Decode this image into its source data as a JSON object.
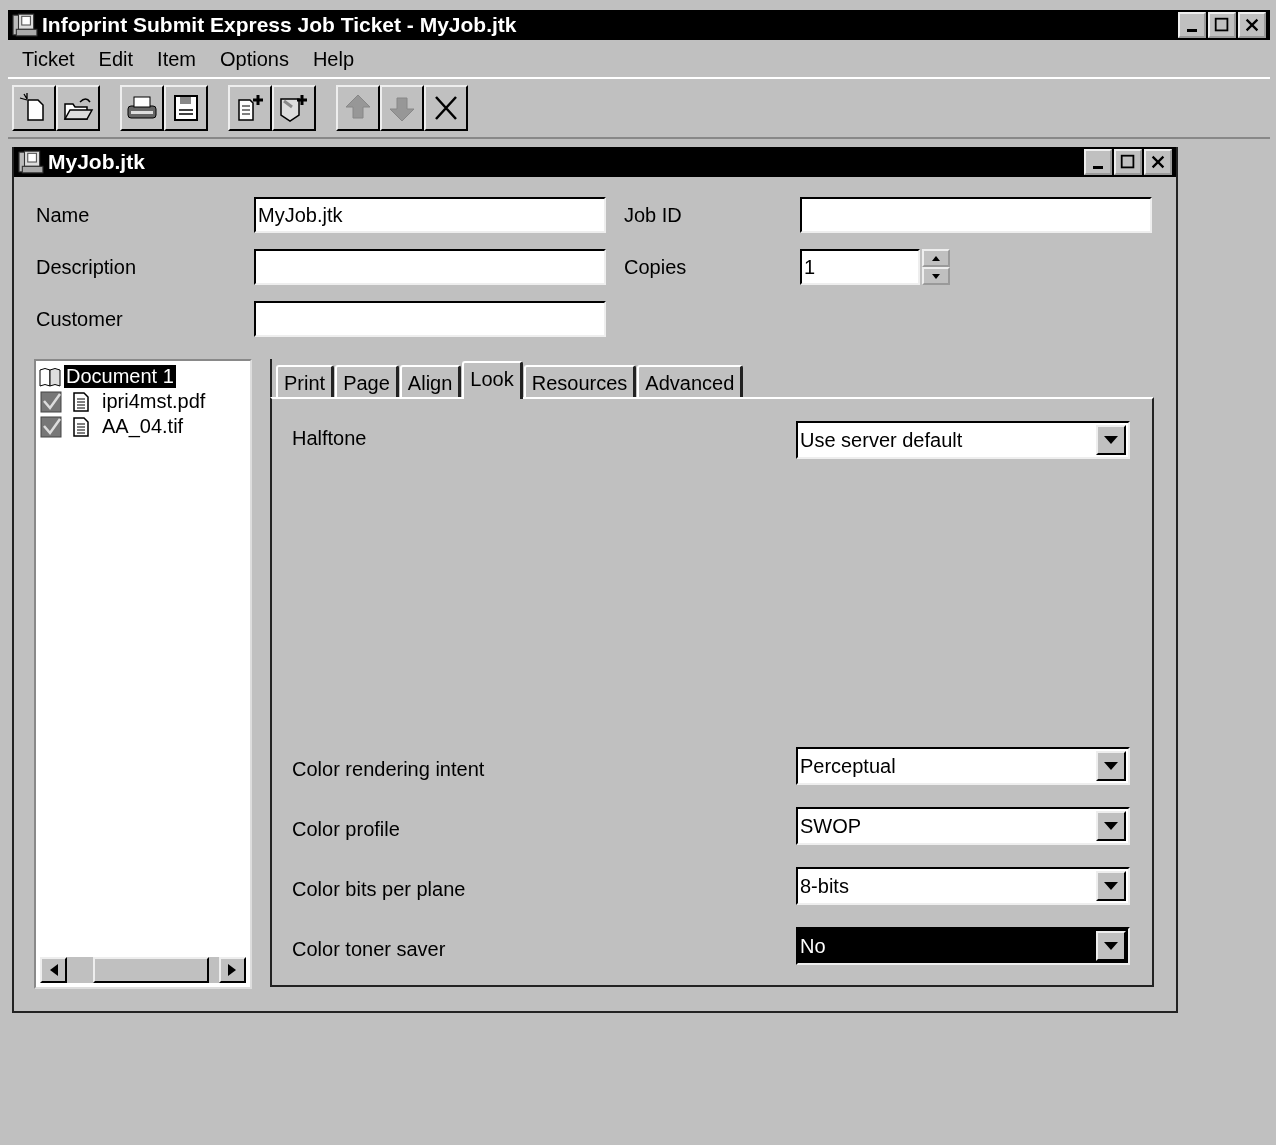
{
  "window": {
    "title": "Infoprint Submit Express Job Ticket - MyJob.jtk"
  },
  "menu": [
    {
      "label": "Ticket"
    },
    {
      "label": "Edit"
    },
    {
      "label": "Item"
    },
    {
      "label": "Options"
    },
    {
      "label": "Help"
    }
  ],
  "toolbar": [
    {
      "kind": "new",
      "disabled": false
    },
    {
      "kind": "open",
      "disabled": false
    },
    {
      "kind": "print",
      "disabled": false
    },
    {
      "kind": "save",
      "disabled": false
    },
    {
      "kind": "add-file",
      "disabled": false
    },
    {
      "kind": "add-document",
      "disabled": false
    },
    {
      "kind": "up",
      "disabled": true
    },
    {
      "kind": "down",
      "disabled": true
    },
    {
      "kind": "delete",
      "disabled": false
    }
  ],
  "document_window": {
    "title": "MyJob.jtk"
  },
  "fields": [
    {
      "label": "Name",
      "value": "MyJob.jtk",
      "kind": "text"
    },
    {
      "label": "Job ID",
      "kind": "text"
    },
    {
      "label": "Description",
      "kind": "text"
    },
    {
      "label": "Copies",
      "value": "1",
      "kind": "spin"
    },
    {
      "label": "Customer",
      "kind": "text"
    }
  ],
  "tree": [
    {
      "label": "Document 1",
      "selected": true,
      "children": [
        {
          "label": "ipri4mst.pdf",
          "checked": true,
          "selected": false
        },
        {
          "label": "AA_04.tif",
          "checked": true,
          "selected": false
        }
      ]
    }
  ],
  "tabs": [
    {
      "label": "Print",
      "selected": false
    },
    {
      "label": "Page",
      "selected": false
    },
    {
      "label": "Align",
      "selected": false
    },
    {
      "label": "Look",
      "selected": true
    },
    {
      "label": "Resources",
      "selected": false
    },
    {
      "label": "Advanced",
      "selected": false
    }
  ],
  "settings": [
    {
      "label": "Halftone",
      "value": "Use server default",
      "focused": false
    },
    {
      "label": "Color rendering intent",
      "value": "Perceptual",
      "focused": false
    },
    {
      "label": "Color profile",
      "value": "SWOP",
      "focused": false
    },
    {
      "label": "Color bits per plane",
      "value": "8-bits",
      "focused": false
    },
    {
      "label": "Color toner saver",
      "value": "No",
      "focused": true
    }
  ]
}
